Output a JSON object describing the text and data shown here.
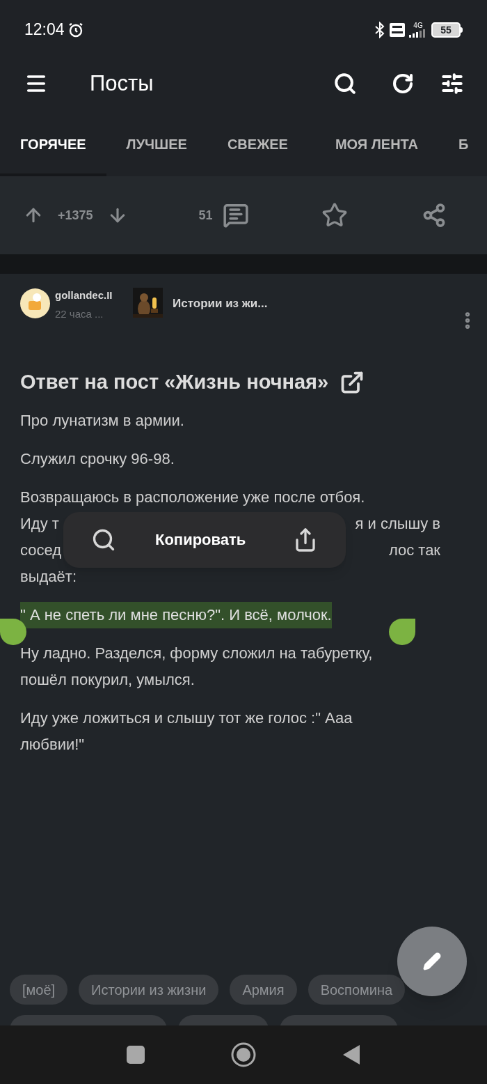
{
  "status_bar": {
    "time": "12:04",
    "battery": "55",
    "network": "4G"
  },
  "app_bar": {
    "title": "Посты"
  },
  "tabs": [
    {
      "label": "ГОРЯЧЕЕ",
      "selected": true
    },
    {
      "label": "ЛУЧШЕЕ",
      "selected": false
    },
    {
      "label": "СВЕЖЕЕ",
      "selected": false
    },
    {
      "label": "МОЯ ЛЕНТА",
      "selected": false
    },
    {
      "label": "Б",
      "selected": false
    }
  ],
  "post_actions": {
    "rating": "+1375",
    "comments": "51"
  },
  "post": {
    "author": "gollandec.II",
    "time": "22 часа ...",
    "community": "Истории из жи...",
    "title": "Ответ на пост «Жизнь ночная»",
    "paragraphs": [
      {
        "lines": [
          [
            "Про лунатизм в армии."
          ]
        ]
      },
      {
        "lines": [
          [
            "Служил срочку 96-98."
          ]
        ]
      },
      {
        "lines": [
          [
            "Возвращаюсь в расположение уже после отбоя."
          ],
          [
            "Иду т",
            "я и слышу в"
          ],
          [
            "сосед",
            "лос так"
          ],
          [
            "выдаёт:"
          ]
        ]
      },
      {
        "lines": [
          [
            "\" А не спеть ли мне песню?\". И всё, молчок."
          ]
        ],
        "selected": true
      },
      {
        "lines": [
          [
            "Ну ладно. Разделся, форму сложил на табуретку,"
          ],
          [
            "пошёл покурил, умылся."
          ]
        ]
      },
      {
        "lines": [
          [
            "Иду уже ложиться и слышу тот же голос :\" Ааа"
          ],
          [
            "любвии!\""
          ]
        ]
      }
    ],
    "tags": [
      "[моё]",
      "Истории из жизни",
      "Армия",
      "Воспомина"
    ]
  },
  "selection_menu": {
    "action": "Копировать"
  }
}
